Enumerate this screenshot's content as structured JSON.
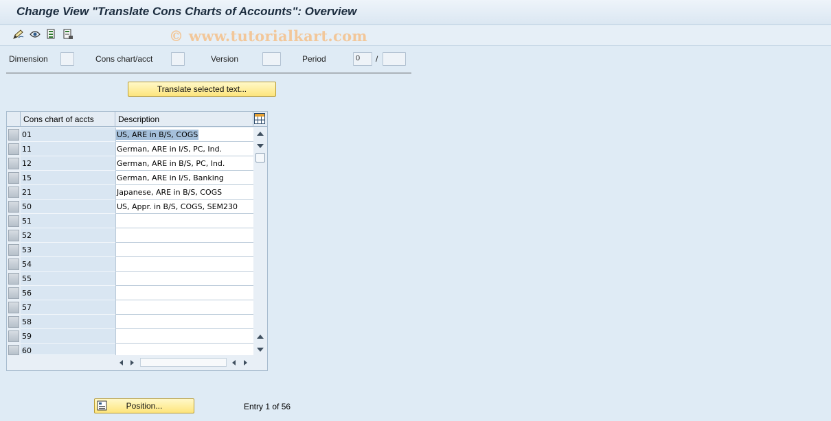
{
  "title": "Change View \"Translate Cons Charts of Accounts\": Overview",
  "toolbar": {
    "icons": [
      "change-display-icon",
      "other-view-icon",
      "select-all-icon",
      "deselect-all-icon"
    ],
    "watermark": "© www.tutorialkart.com"
  },
  "fields": {
    "dimension_label": "Dimension",
    "dimension_value": "",
    "chart_label": "Cons chart/acct",
    "chart_value": "",
    "version_label": "Version",
    "version_value": "",
    "period_label": "Period",
    "period_value": "0",
    "period_sep": "/",
    "year_value": ""
  },
  "translate_button": "Translate selected text...",
  "table": {
    "col1_header": "Cons chart of accts",
    "col2_header": "Description",
    "rows": [
      {
        "code": "01",
        "desc": "US, ARE in B/S, COGS",
        "selected": true
      },
      {
        "code": "11",
        "desc": "German, ARE in I/S, PC, Ind."
      },
      {
        "code": "12",
        "desc": "German, ARE in B/S, PC, Ind."
      },
      {
        "code": "15",
        "desc": "German, ARE in I/S, Banking"
      },
      {
        "code": "21",
        "desc": "Japanese, ARE in B/S, COGS"
      },
      {
        "code": "50",
        "desc": "US, Appr. in B/S, COGS, SEM230"
      },
      {
        "code": "51",
        "desc": ""
      },
      {
        "code": "52",
        "desc": ""
      },
      {
        "code": "53",
        "desc": ""
      },
      {
        "code": "54",
        "desc": ""
      },
      {
        "code": "55",
        "desc": ""
      },
      {
        "code": "56",
        "desc": ""
      },
      {
        "code": "57",
        "desc": ""
      },
      {
        "code": "58",
        "desc": ""
      },
      {
        "code": "59",
        "desc": ""
      },
      {
        "code": "60",
        "desc": ""
      }
    ]
  },
  "position_button": "Position...",
  "entry_text": "Entry 1 of 56",
  "colors": {
    "background": "#dfebf5",
    "key_column": "#d9e6f2",
    "selection": "#a5c0db",
    "button": "#fde57c"
  }
}
